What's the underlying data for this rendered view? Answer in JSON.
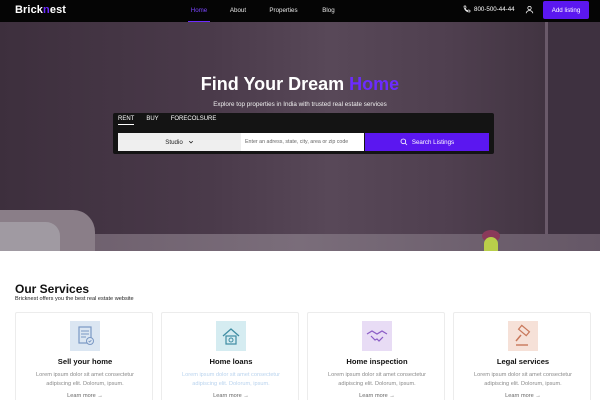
{
  "nav": {
    "logo_pre": "Brick",
    "logo_accent": "n",
    "logo_post": "est",
    "links": [
      "Home",
      "About",
      "Properties",
      "Blog"
    ],
    "active_link": "Home",
    "phone": "800-500-44-44",
    "add_listing": "Add listing"
  },
  "hero": {
    "title_main": "Find Your Dream",
    "title_accent": "Home",
    "subtitle": "Explore top properties in India with trusted real estate services",
    "tabs": [
      "RENT",
      "BUY",
      "FORECOLSURE"
    ],
    "active_tab": "RENT",
    "property_type": "Studio",
    "search_placeholder": "Enter an adress, state, city, area or zip code",
    "search_button": "Search Listings"
  },
  "services": {
    "title": "Our Services",
    "subtitle": "Bricknest offers you the best real estate website",
    "cards": [
      {
        "title": "Sell your home",
        "desc": "Lorem ipsum dolor sit amet consectetur adipiscing elit. Dolorum, ipsum.",
        "more": "Learn more",
        "icon": "sell-home-icon",
        "icon_bg": "#dbe6f2"
      },
      {
        "title": "Home loans",
        "desc": "Lorem ipsum dolor sit amet consectetur adipiscing elit. Dolorum, ipsum.",
        "more": "Learn more",
        "icon": "home-loan-icon",
        "icon_bg": "#d5ecf1"
      },
      {
        "title": "Home inspection",
        "desc": "Lorem ipsum dolor sit amet consectetur adipiscing elit. Dolorum, ipsum.",
        "more": "Learn more",
        "icon": "handshake-icon",
        "icon_bg": "#e8dcf5"
      },
      {
        "title": "Legal services",
        "desc": "Lorem ipsum dolor sit amet consectetur adipiscing elit. Dolorum, ipsum.",
        "more": "Learn more",
        "icon": "gavel-icon",
        "icon_bg": "#f6e1d8"
      }
    ]
  },
  "colors": {
    "accent": "#5b17f0",
    "nav_bg": "#050505",
    "search_bg": "#141414"
  }
}
